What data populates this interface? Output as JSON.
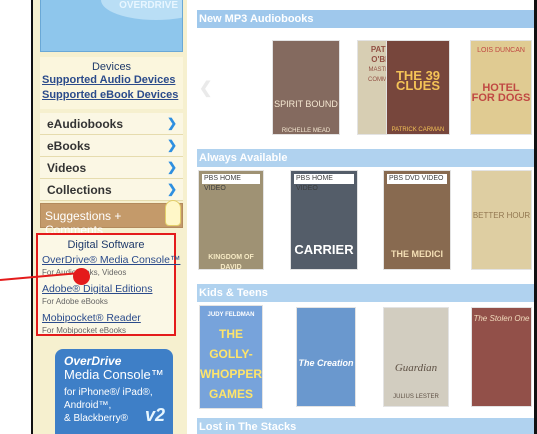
{
  "promo_top": {
    "text": "OVERDRIVE"
  },
  "devices": {
    "header": "Devices",
    "links": [
      "Supported Audio Devices",
      "Supported eBook Devices"
    ]
  },
  "nav": {
    "items": [
      "eAudiobooks",
      "eBooks",
      "Videos",
      "Collections"
    ]
  },
  "suggestions": "Suggestions + Comments",
  "digital_software": {
    "header": "Digital Software",
    "items": [
      {
        "link": "OverDrive® Media Console™",
        "sub": "For Audiobooks, Videos"
      },
      {
        "link": "Adobe® Digital Editions",
        "sub": "For Adobe eBooks"
      },
      {
        "link": "Mobipocket® Reader",
        "sub": "For Mobipocket eBooks"
      }
    ]
  },
  "overdrive_ad": {
    "brand": "OverDrive",
    "product": "Media Console™",
    "platforms": [
      "for iPhone®/ iPad®,",
      "Android™,",
      "& Blackberry®"
    ],
    "version": "v2"
  },
  "sections": [
    {
      "title": "New MP3 Audiobooks",
      "books": [
        {
          "title": "SPIRIT BOUND",
          "author": "RICHELLE MEAD",
          "bg": "#6a4a3c",
          "fg": "#f3e3c8"
        },
        {
          "title": "PATRICK O'BRIAN",
          "author": "MASTER AND COMMANDER",
          "bg": "#cfc4a3",
          "fg": "#7a2a1a"
        },
        {
          "title": "THE 39 CLUES",
          "author": "PATRICK CARMAN",
          "bg": "#5a1e12",
          "fg": "#f2b632"
        },
        {
          "title": "HOTEL FOR DOGS",
          "author": "LOIS DUNCAN",
          "bg": "#d9c07a",
          "fg": "#b3201a"
        }
      ]
    },
    {
      "title": "Always Available",
      "books": [
        {
          "label": "PBS HOME VIDEO",
          "title": "KINGDOM OF DAVID",
          "bg": "#8a7a56",
          "fg": "#f5e6b8"
        },
        {
          "label": "PBS HOME VIDEO",
          "title": "CARRIER",
          "bg": "#2f3a48",
          "fg": "#ffffff"
        },
        {
          "label": "PBS DVD VIDEO",
          "title": "THE MEDICI",
          "bg": "#6e4a2a",
          "fg": "#f3d9a6"
        },
        {
          "title": "BETTER HOUR",
          "bg": "#d7c48e",
          "fg": "#7a5a2a"
        }
      ]
    },
    {
      "title": "Kids & Teens",
      "books": [
        {
          "author": "JUDY FELDMAN",
          "title": "THE GOLLY-WHOPPER GAMES",
          "bg": "#5a8fd4",
          "fg": "#ffe04a"
        },
        {
          "title": "The Creation",
          "bg": "#4a82c4",
          "fg": "#ffffff"
        },
        {
          "title": "Guardian",
          "author": "JULIUS LESTER",
          "bg": "#c9c2b3",
          "fg": "#3a2a1a"
        },
        {
          "title": "The Stolen One",
          "bg": "#7a2a22",
          "fg": "#f1d6b0"
        }
      ]
    },
    {
      "title": "Lost in The Stacks",
      "books": []
    }
  ]
}
